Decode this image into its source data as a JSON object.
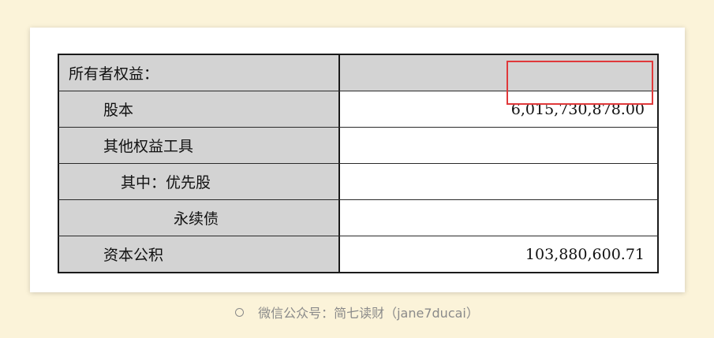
{
  "table": {
    "rows": [
      {
        "label": "所有者权益：",
        "value": ""
      },
      {
        "label": "股本",
        "value": "6,015,730,878.00"
      },
      {
        "label": "其他权益工具",
        "value": ""
      },
      {
        "label": "其中：优先股",
        "value": ""
      },
      {
        "label": "永续债",
        "value": ""
      },
      {
        "label": "资本公积",
        "value": "103,880,600.71"
      }
    ]
  },
  "highlight": {
    "color": "#e0383a"
  },
  "caption": {
    "icon": "circle-icon",
    "text": "微信公众号：简七读财（jane7ducai）"
  }
}
